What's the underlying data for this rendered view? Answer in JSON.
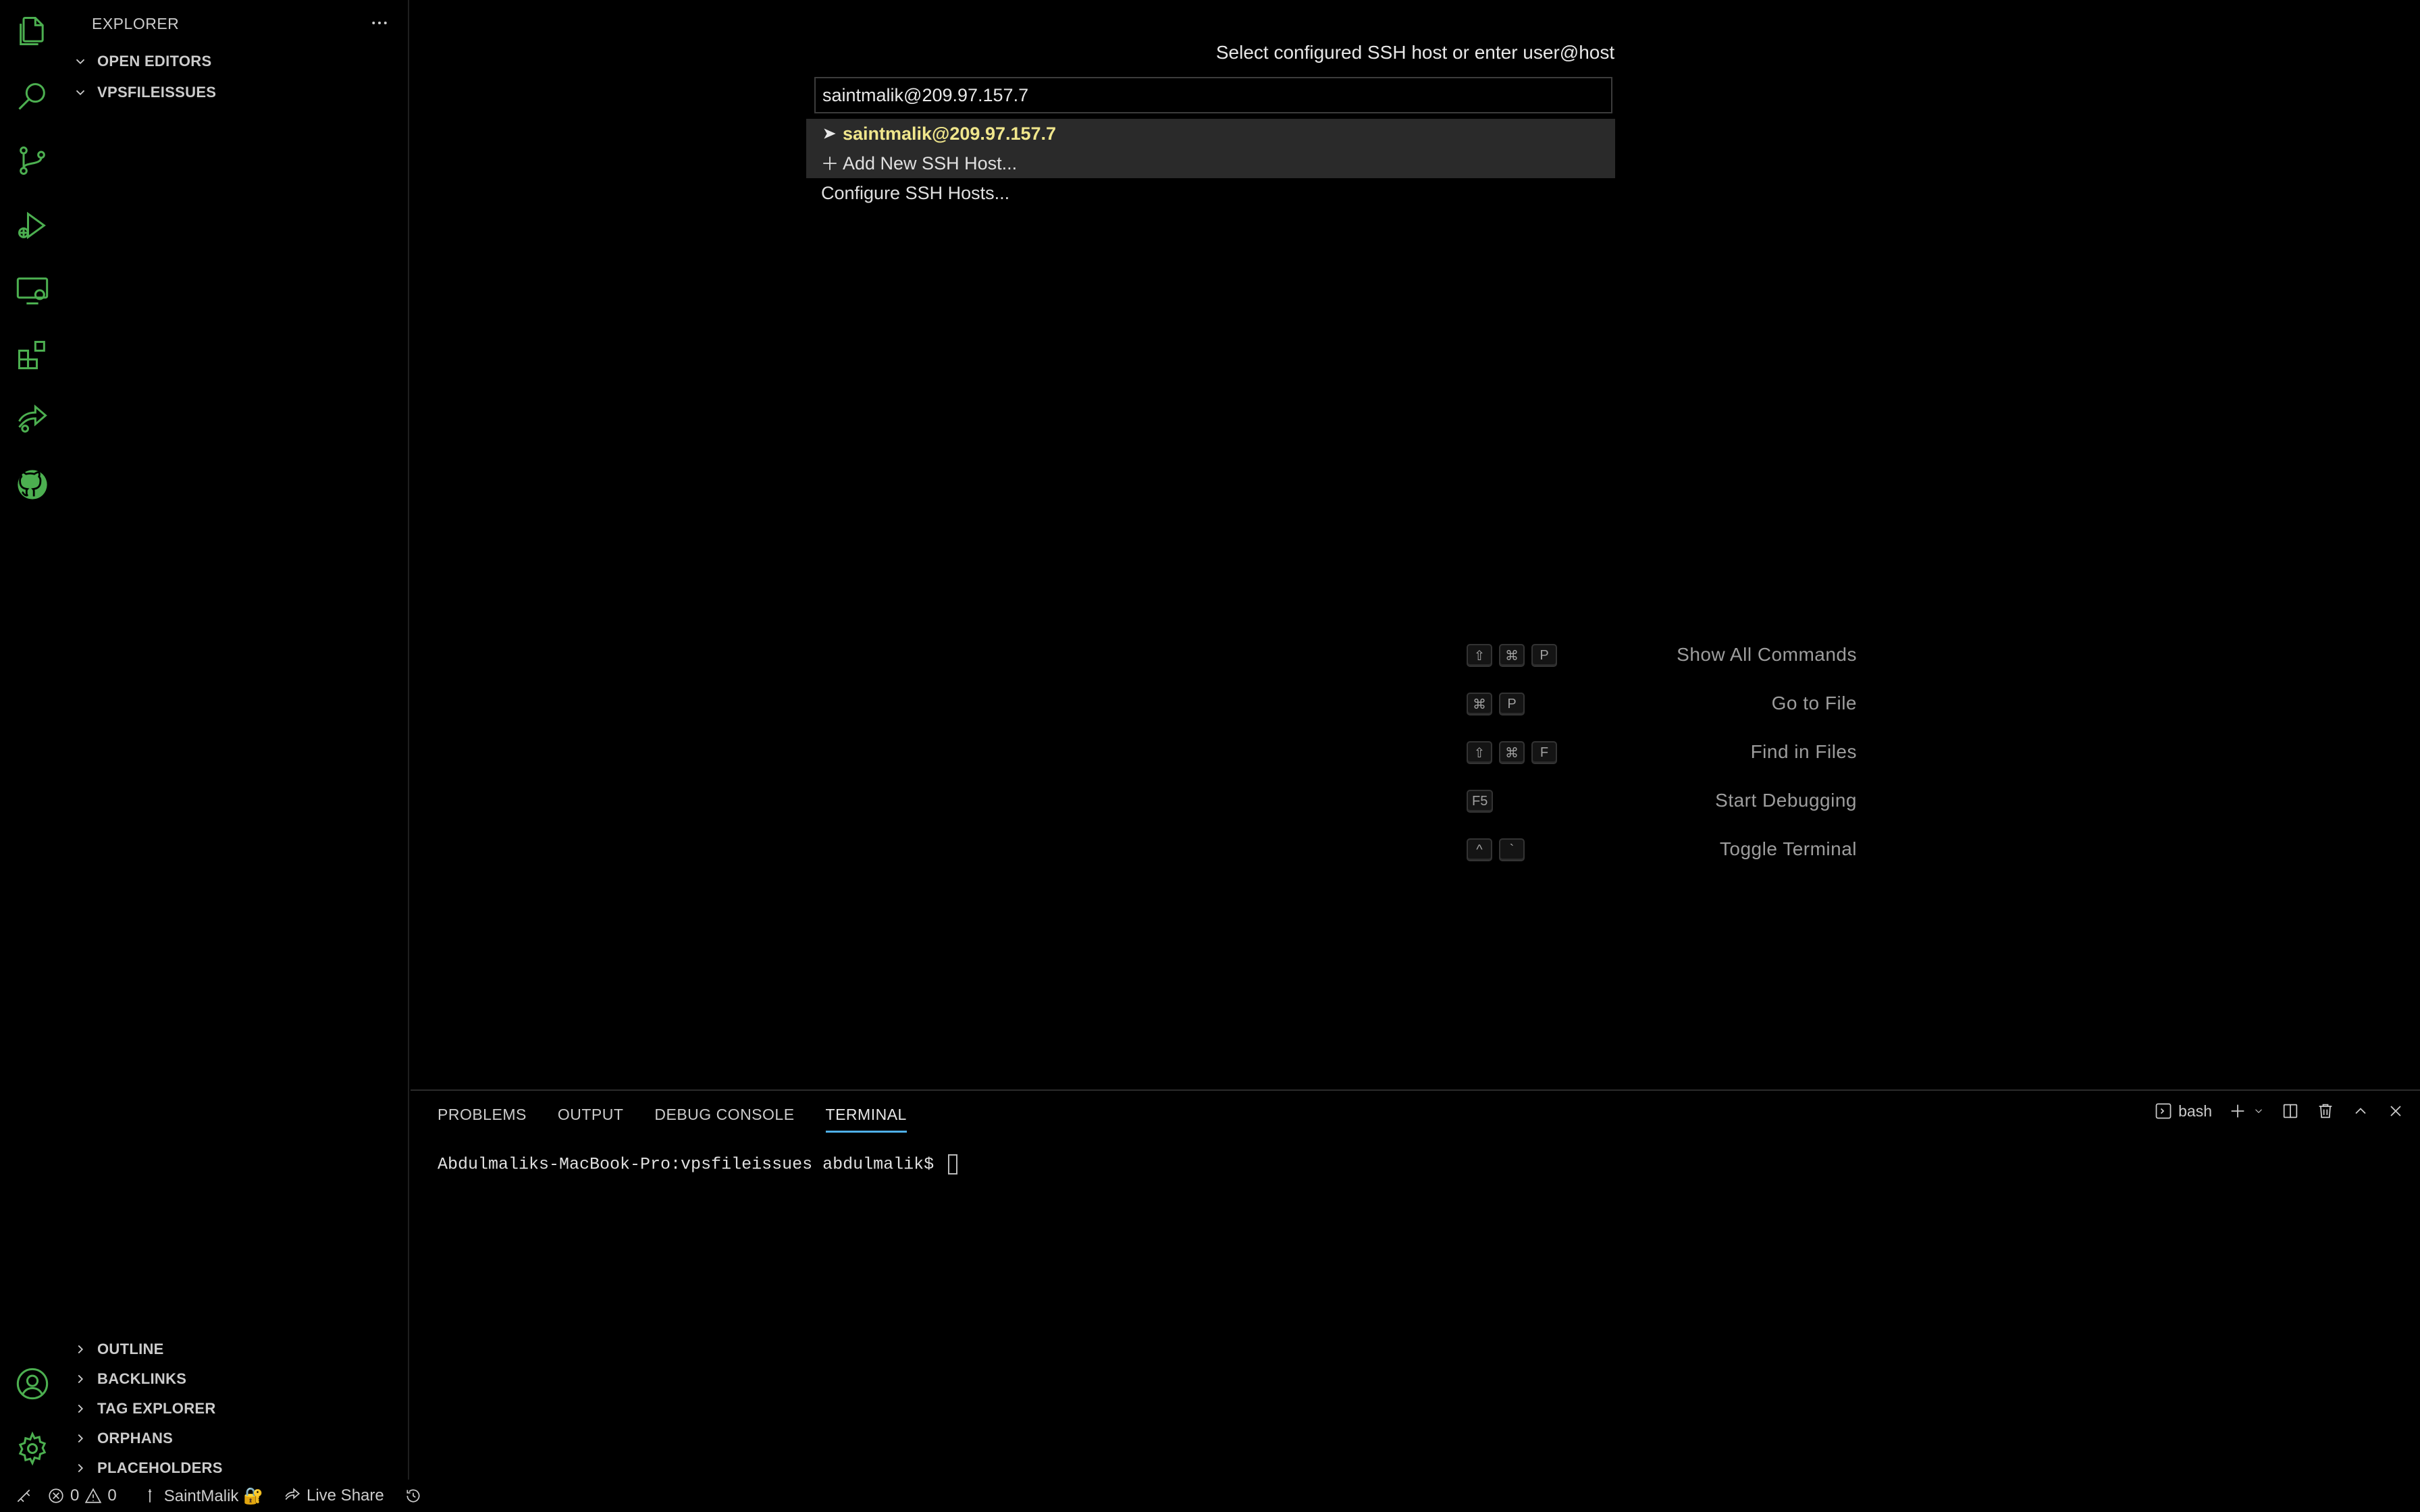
{
  "colors": {
    "accent": "#4caf50",
    "quickpick_highlight": "#f0e68c",
    "active_tab_underline": "#4fb0e8"
  },
  "activity_bar": {
    "icons": [
      "files-icon",
      "search-icon",
      "source-control-icon",
      "run-debug-icon",
      "remote-explorer-icon",
      "extensions-icon",
      "live-share-icon",
      "github-icon",
      "account-icon",
      "settings-gear-icon"
    ]
  },
  "sidebar": {
    "title": "EXPLORER",
    "sections_top": [
      {
        "label": "OPEN EDITORS"
      },
      {
        "label": "VPSFILEISSUES"
      }
    ],
    "sections_bottom": [
      {
        "label": "OUTLINE"
      },
      {
        "label": "BACKLINKS"
      },
      {
        "label": "TAG EXPLORER"
      },
      {
        "label": "ORPHANS"
      },
      {
        "label": "PLACEHOLDERS"
      }
    ]
  },
  "quick_pick": {
    "title": "Select configured SSH host or enter user@host",
    "input_value": "saintmalik@209.97.157.7",
    "items": [
      {
        "label": "saintmalik@209.97.157.7",
        "icon": "arrow-right-icon"
      },
      {
        "label": "Add New SSH Host...",
        "icon": "plus-icon"
      },
      {
        "label": "Configure SSH Hosts...",
        "icon": ""
      }
    ]
  },
  "shortcuts": [
    {
      "label": "Show All Commands",
      "keys": [
        "⇧",
        "⌘",
        "P"
      ]
    },
    {
      "label": "Go to File",
      "keys": [
        "⌘",
        "P"
      ]
    },
    {
      "label": "Find in Files",
      "keys": [
        "⇧",
        "⌘",
        "F"
      ]
    },
    {
      "label": "Start Debugging",
      "keys": [
        "F5"
      ]
    },
    {
      "label": "Toggle Terminal",
      "keys": [
        "^",
        "`"
      ]
    }
  ],
  "panel": {
    "tabs": [
      "PROBLEMS",
      "OUTPUT",
      "DEBUG CONSOLE",
      "TERMINAL"
    ],
    "active_tab": "TERMINAL",
    "terminal_name": "bash",
    "prompt": "Abdulmaliks-MacBook-Pro:vpsfileissues abdulmalik$ "
  },
  "status_bar": {
    "errors": "0",
    "warnings": "0",
    "user": "SaintMalik 🔐",
    "live_share": "Live Share"
  }
}
